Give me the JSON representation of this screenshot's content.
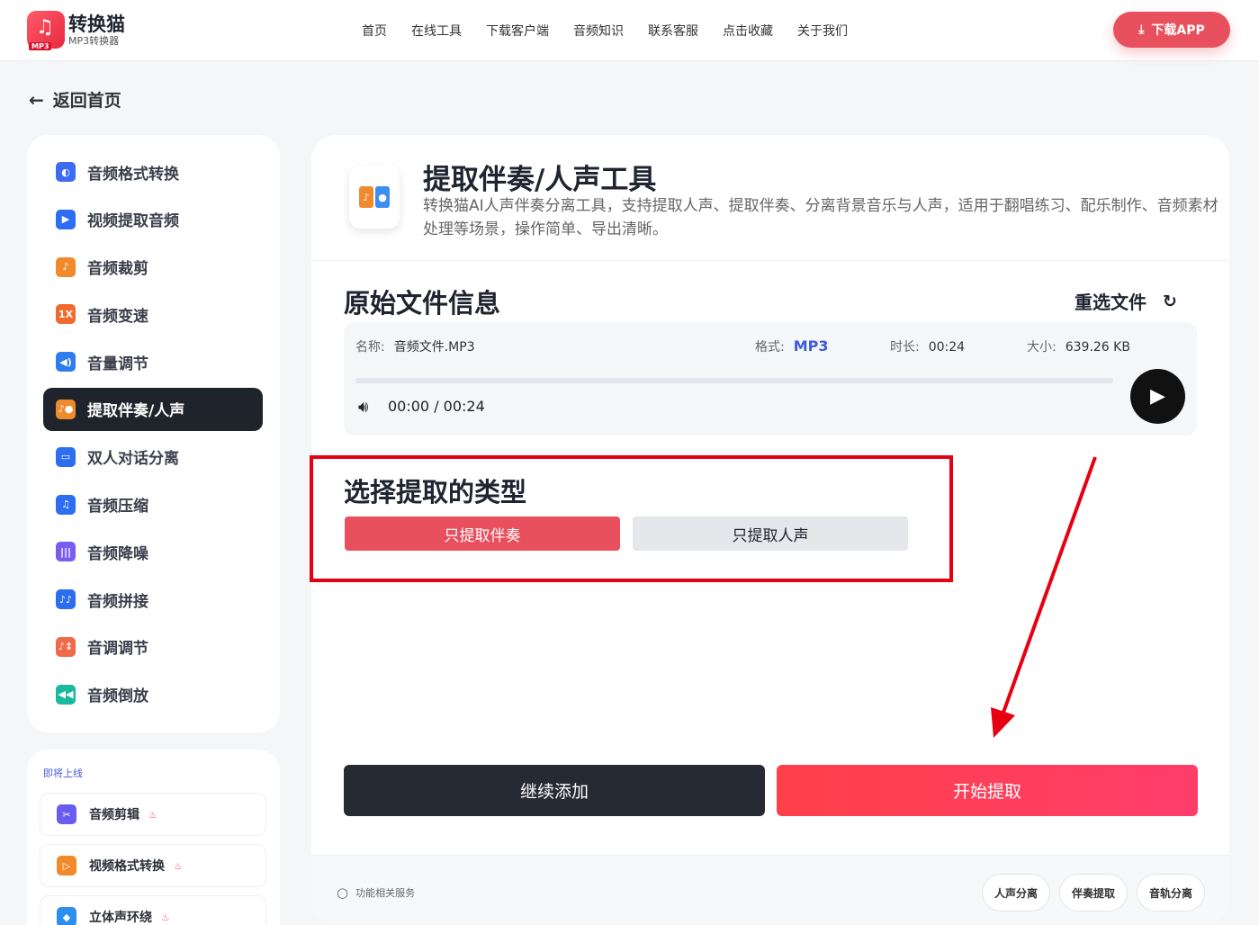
{
  "header": {
    "logo_title": "转换猫",
    "logo_sub": "MP3转换器",
    "logo_tag": "MP3",
    "nav": [
      "首页",
      "在线工具",
      "下载客户端",
      "音频知识",
      "联系客服",
      "点击收藏",
      "关于我们"
    ],
    "download_label": "下载APP"
  },
  "back_label": "返回首页",
  "sidebar": {
    "items": [
      {
        "label": "音频格式转换",
        "icon": "format-icon",
        "color": "#3d6cf0"
      },
      {
        "label": "视频提取音频",
        "icon": "video-icon",
        "color": "#2d6df0"
      },
      {
        "label": "音频裁剪",
        "icon": "crop-icon",
        "color": "#f08a2d"
      },
      {
        "label": "音频变速",
        "icon": "speed-icon",
        "color": "#f06a2d"
      },
      {
        "label": "音量调节",
        "icon": "volume-icon",
        "color": "#2d7cf0"
      },
      {
        "label": "提取伴奏/人声",
        "icon": "extract-icon",
        "color": "#f08a2d"
      },
      {
        "label": "双人对话分离",
        "icon": "dialog-icon",
        "color": "#2d6df0"
      },
      {
        "label": "音频压缩",
        "icon": "compress-icon",
        "color": "#2d6df0"
      },
      {
        "label": "音频降噪",
        "icon": "denoise-icon",
        "color": "#7a5cf0"
      },
      {
        "label": "音频拼接",
        "icon": "merge-icon",
        "color": "#2d6df0"
      },
      {
        "label": "音调调节",
        "icon": "pitch-icon",
        "color": "#f06a4a"
      },
      {
        "label": "音频倒放",
        "icon": "reverse-icon",
        "color": "#1bb8a0"
      }
    ],
    "active_index": 5
  },
  "soon": {
    "label": "即将上线",
    "items": [
      {
        "label": "音频剪辑",
        "icon": "scissors-icon",
        "color": "#6a5cf0"
      },
      {
        "label": "视频格式转换",
        "icon": "video-convert-icon",
        "color": "#f08a2d"
      },
      {
        "label": "立体声环绕",
        "icon": "surround-icon",
        "color": "#2d8ef0"
      }
    ]
  },
  "tool": {
    "title": "提取伴奏/人声工具",
    "description": "转换猫AI人声伴奏分离工具，支持提取人声、提取伴奏、分离背景音乐与人声，适用于翻唱练习、配乐制作、音频素材处理等场景，操作简单、导出清晰。"
  },
  "file_info": {
    "section_title": "原始文件信息",
    "reselect_label": "重选文件",
    "name_key": "名称:",
    "name_value": "音频文件.MP3",
    "format_key": "格式:",
    "format_value": "MP3",
    "duration_key": "时长:",
    "duration_value": "00:24",
    "size_key": "大小:",
    "size_value": "639.26 KB",
    "time_display": "00:00 / 00:24",
    "progress": 0
  },
  "extract_type": {
    "title": "选择提取的类型",
    "options": [
      "只提取伴奏",
      "只提取人声"
    ],
    "selected_index": 0
  },
  "actions": {
    "add_label": "继续添加",
    "start_label": "开始提取"
  },
  "footer": {
    "search_label": "功能相关服务",
    "chips": [
      "人声分离",
      "伴奏提取",
      "音轨分离"
    ]
  },
  "colors": {
    "accent": "#e9505e",
    "annotation_red": "#e60012",
    "dark": "#1f232b"
  }
}
